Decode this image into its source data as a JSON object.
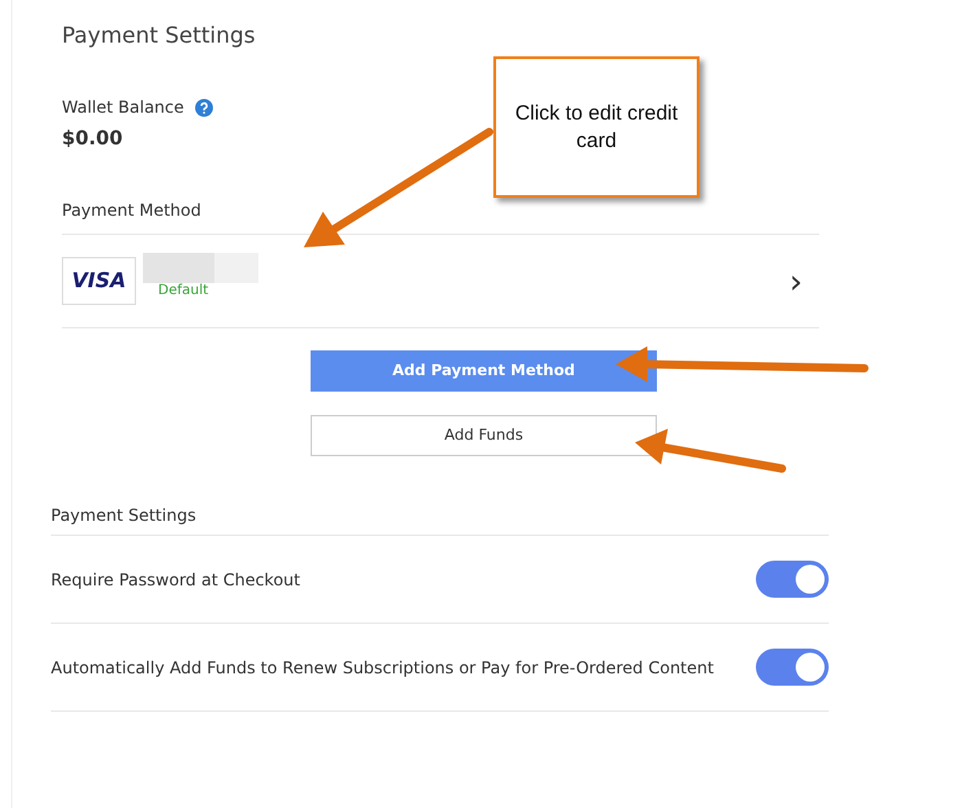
{
  "title": "Payment Settings",
  "wallet": {
    "label": "Wallet Balance",
    "amount": "$0.00"
  },
  "payment_method": {
    "label": "Payment Method",
    "card_brand": "VISA",
    "status": "Default",
    "chevron": "›"
  },
  "buttons": [
    {
      "label": "Add Payment Method",
      "kind": "primary"
    },
    {
      "label": "Add Funds",
      "kind": "outline"
    }
  ],
  "settings": {
    "heading": "Payment Settings",
    "items": [
      {
        "label": "Require Password at Checkout",
        "on": true
      },
      {
        "label": "Automatically Add Funds to Renew Subscriptions or Pay for Pre-Ordered Content",
        "on": true
      }
    ]
  },
  "annotation": {
    "text": "Click to edit credit card"
  }
}
